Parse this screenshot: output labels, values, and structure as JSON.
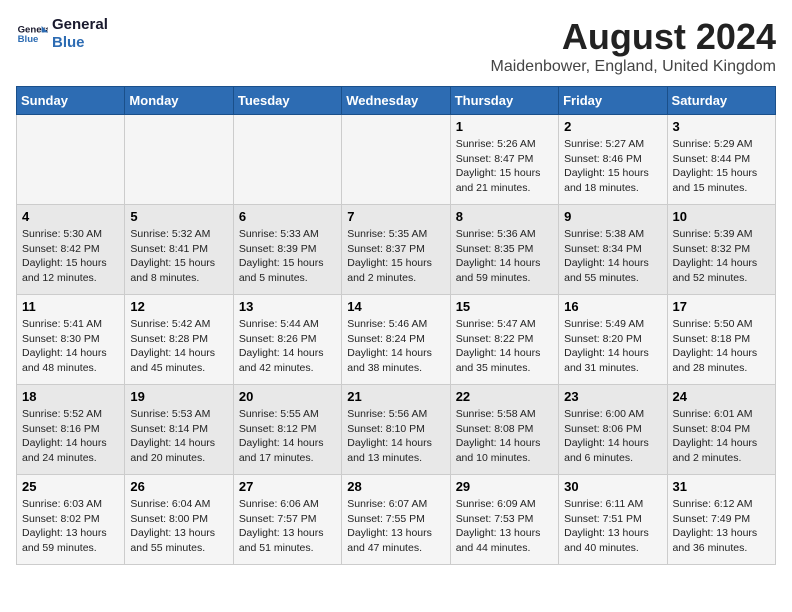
{
  "header": {
    "logo_line1": "General",
    "logo_line2": "Blue",
    "month_year": "August 2024",
    "location": "Maidenbower, England, United Kingdom"
  },
  "days_of_week": [
    "Sunday",
    "Monday",
    "Tuesday",
    "Wednesday",
    "Thursday",
    "Friday",
    "Saturday"
  ],
  "weeks": [
    [
      {
        "day": "",
        "info": ""
      },
      {
        "day": "",
        "info": ""
      },
      {
        "day": "",
        "info": ""
      },
      {
        "day": "",
        "info": ""
      },
      {
        "day": "1",
        "info": "Sunrise: 5:26 AM\nSunset: 8:47 PM\nDaylight: 15 hours\nand 21 minutes."
      },
      {
        "day": "2",
        "info": "Sunrise: 5:27 AM\nSunset: 8:46 PM\nDaylight: 15 hours\nand 18 minutes."
      },
      {
        "day": "3",
        "info": "Sunrise: 5:29 AM\nSunset: 8:44 PM\nDaylight: 15 hours\nand 15 minutes."
      }
    ],
    [
      {
        "day": "4",
        "info": "Sunrise: 5:30 AM\nSunset: 8:42 PM\nDaylight: 15 hours\nand 12 minutes."
      },
      {
        "day": "5",
        "info": "Sunrise: 5:32 AM\nSunset: 8:41 PM\nDaylight: 15 hours\nand 8 minutes."
      },
      {
        "day": "6",
        "info": "Sunrise: 5:33 AM\nSunset: 8:39 PM\nDaylight: 15 hours\nand 5 minutes."
      },
      {
        "day": "7",
        "info": "Sunrise: 5:35 AM\nSunset: 8:37 PM\nDaylight: 15 hours\nand 2 minutes."
      },
      {
        "day": "8",
        "info": "Sunrise: 5:36 AM\nSunset: 8:35 PM\nDaylight: 14 hours\nand 59 minutes."
      },
      {
        "day": "9",
        "info": "Sunrise: 5:38 AM\nSunset: 8:34 PM\nDaylight: 14 hours\nand 55 minutes."
      },
      {
        "day": "10",
        "info": "Sunrise: 5:39 AM\nSunset: 8:32 PM\nDaylight: 14 hours\nand 52 minutes."
      }
    ],
    [
      {
        "day": "11",
        "info": "Sunrise: 5:41 AM\nSunset: 8:30 PM\nDaylight: 14 hours\nand 48 minutes."
      },
      {
        "day": "12",
        "info": "Sunrise: 5:42 AM\nSunset: 8:28 PM\nDaylight: 14 hours\nand 45 minutes."
      },
      {
        "day": "13",
        "info": "Sunrise: 5:44 AM\nSunset: 8:26 PM\nDaylight: 14 hours\nand 42 minutes."
      },
      {
        "day": "14",
        "info": "Sunrise: 5:46 AM\nSunset: 8:24 PM\nDaylight: 14 hours\nand 38 minutes."
      },
      {
        "day": "15",
        "info": "Sunrise: 5:47 AM\nSunset: 8:22 PM\nDaylight: 14 hours\nand 35 minutes."
      },
      {
        "day": "16",
        "info": "Sunrise: 5:49 AM\nSunset: 8:20 PM\nDaylight: 14 hours\nand 31 minutes."
      },
      {
        "day": "17",
        "info": "Sunrise: 5:50 AM\nSunset: 8:18 PM\nDaylight: 14 hours\nand 28 minutes."
      }
    ],
    [
      {
        "day": "18",
        "info": "Sunrise: 5:52 AM\nSunset: 8:16 PM\nDaylight: 14 hours\nand 24 minutes."
      },
      {
        "day": "19",
        "info": "Sunrise: 5:53 AM\nSunset: 8:14 PM\nDaylight: 14 hours\nand 20 minutes."
      },
      {
        "day": "20",
        "info": "Sunrise: 5:55 AM\nSunset: 8:12 PM\nDaylight: 14 hours\nand 17 minutes."
      },
      {
        "day": "21",
        "info": "Sunrise: 5:56 AM\nSunset: 8:10 PM\nDaylight: 14 hours\nand 13 minutes."
      },
      {
        "day": "22",
        "info": "Sunrise: 5:58 AM\nSunset: 8:08 PM\nDaylight: 14 hours\nand 10 minutes."
      },
      {
        "day": "23",
        "info": "Sunrise: 6:00 AM\nSunset: 8:06 PM\nDaylight: 14 hours\nand 6 minutes."
      },
      {
        "day": "24",
        "info": "Sunrise: 6:01 AM\nSunset: 8:04 PM\nDaylight: 14 hours\nand 2 minutes."
      }
    ],
    [
      {
        "day": "25",
        "info": "Sunrise: 6:03 AM\nSunset: 8:02 PM\nDaylight: 13 hours\nand 59 minutes."
      },
      {
        "day": "26",
        "info": "Sunrise: 6:04 AM\nSunset: 8:00 PM\nDaylight: 13 hours\nand 55 minutes."
      },
      {
        "day": "27",
        "info": "Sunrise: 6:06 AM\nSunset: 7:57 PM\nDaylight: 13 hours\nand 51 minutes."
      },
      {
        "day": "28",
        "info": "Sunrise: 6:07 AM\nSunset: 7:55 PM\nDaylight: 13 hours\nand 47 minutes."
      },
      {
        "day": "29",
        "info": "Sunrise: 6:09 AM\nSunset: 7:53 PM\nDaylight: 13 hours\nand 44 minutes."
      },
      {
        "day": "30",
        "info": "Sunrise: 6:11 AM\nSunset: 7:51 PM\nDaylight: 13 hours\nand 40 minutes."
      },
      {
        "day": "31",
        "info": "Sunrise: 6:12 AM\nSunset: 7:49 PM\nDaylight: 13 hours\nand 36 minutes."
      }
    ]
  ]
}
